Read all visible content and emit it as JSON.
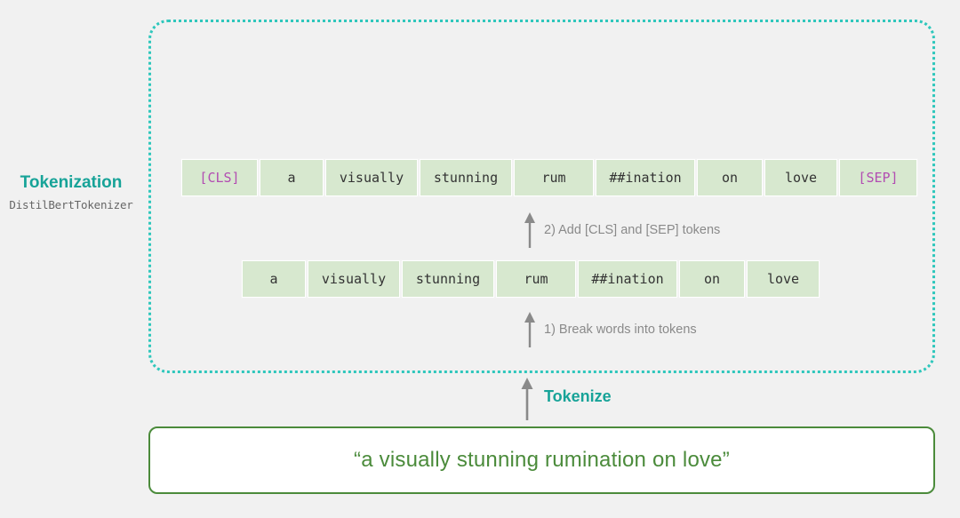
{
  "side": {
    "title": "Tokenization",
    "subtitle": "DistilBertTokenizer"
  },
  "tokens_with_special": [
    "[CLS]",
    "a",
    "visually",
    "stunning",
    "rum",
    "##ination",
    "on",
    "love",
    "[SEP]"
  ],
  "tokens_plain": [
    "a",
    "visually",
    "stunning",
    "rum",
    "##ination",
    "on",
    "love"
  ],
  "steps": {
    "step2": "2) Add [CLS] and [SEP] tokens",
    "step1": "1) Break words into tokens",
    "tokenize": "Tokenize"
  },
  "input_sentence": "“a visually stunning rumination on love”",
  "colors": {
    "teal": "#17a398",
    "token_bg": "#d7e8cf",
    "special_token": "#b24db2",
    "input_border": "#4b8b3b"
  }
}
